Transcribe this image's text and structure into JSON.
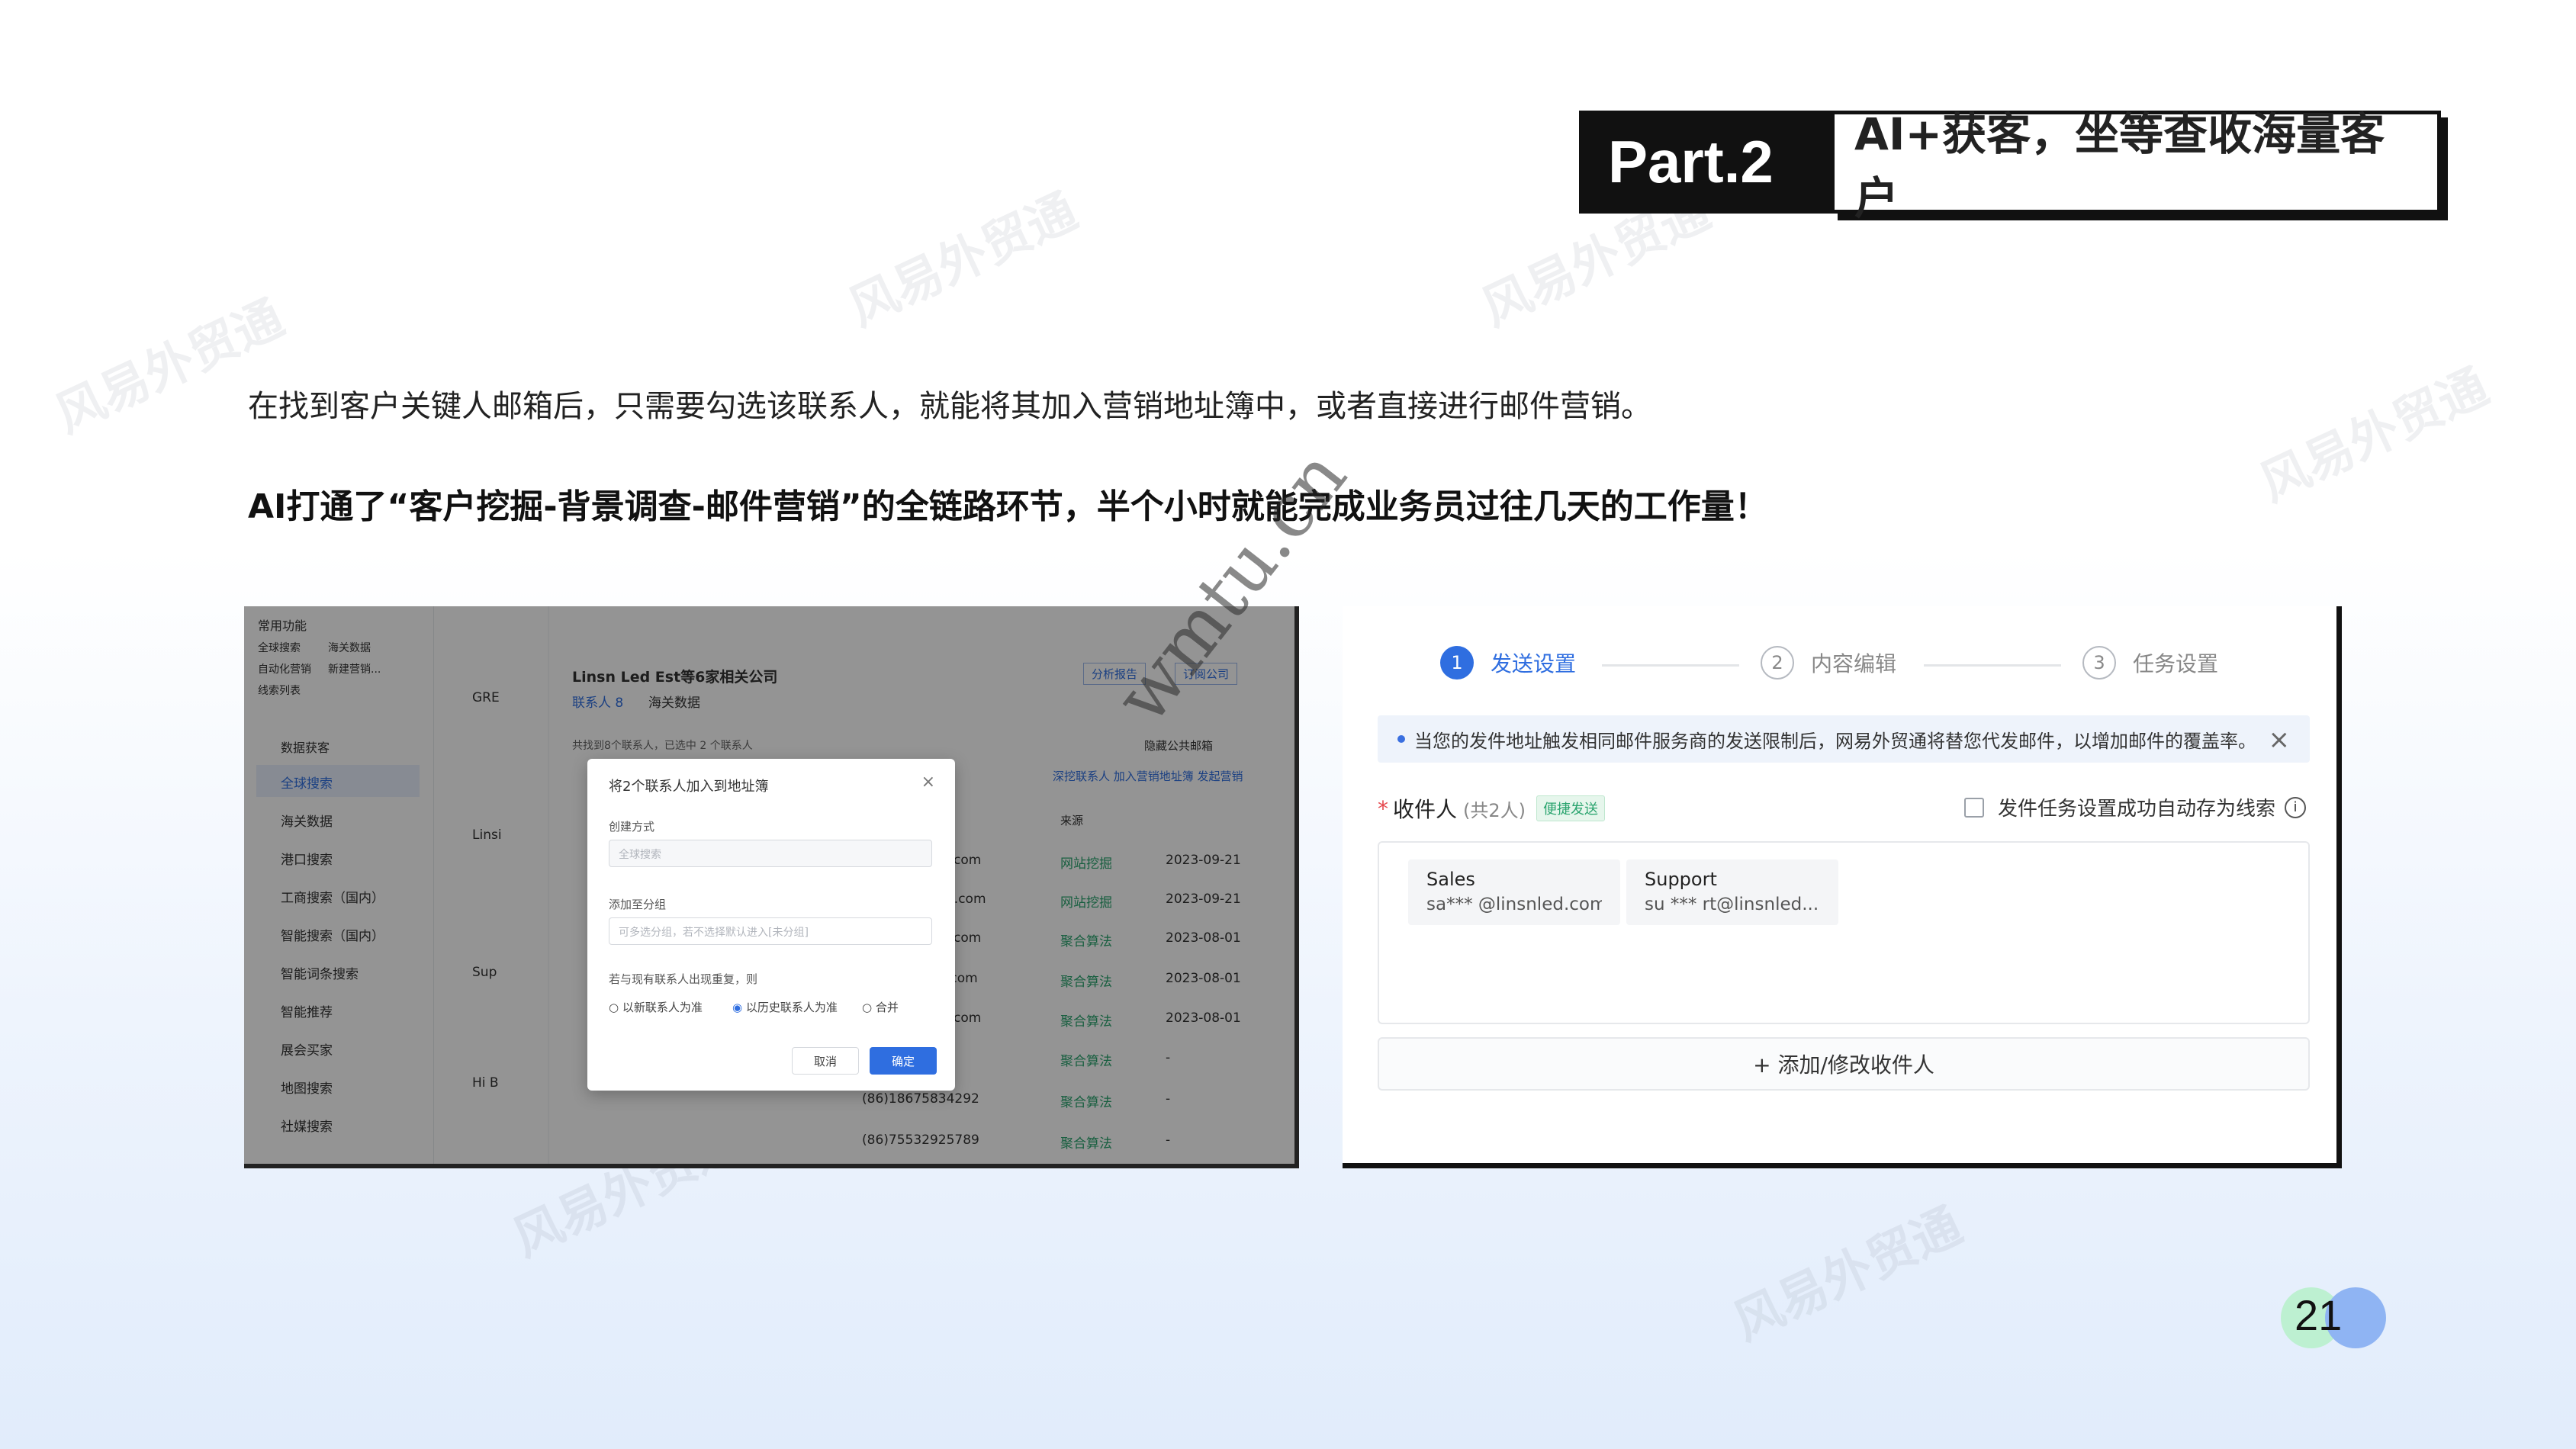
{
  "header": {
    "part_label": "Part.2",
    "title": "AI+获客，坐等查收海量客户"
  },
  "intro_text": "在找到客户关键人邮箱后，只需要勾选该联系人，就能将其加入营销地址簿中，或者直接进行邮件营销。",
  "highlight_text": "AI打通了“客户挖掘-背景调查-邮件营销”的全链路环节，半个小时就能完成业务员过往几天的工作量！",
  "watermarks": [
    "风易外贸通",
    "风易外贸通",
    "风易外贸通",
    "风易外贸通",
    "风易外贸通",
    "风易外贸通",
    "风易外贸通"
  ],
  "diag_watermark": "wmtu.cn",
  "left_shot": {
    "side_head_1": "常用功能",
    "side_row_1a": "全球搜索",
    "side_row_1b": "海关数据",
    "side_row_2a": "自动化营销",
    "side_row_2b": "新建营销...",
    "side_row_3": "线索列表",
    "side_section": "数据获客",
    "side_items": [
      "全球搜索",
      "海关数据",
      "港口搜索",
      "工商搜索（国内）",
      "智能搜索（国内）",
      "智能词条搜索",
      "智能推荐",
      "展会买家",
      "地图搜索",
      "社媒搜索"
    ],
    "company": "Linsn Led Est等6家相关公司",
    "tab_contacts": "联系人 8",
    "tab_customs": "海关数据",
    "btn_report": "分析报告",
    "btn_sub": "订阅公司",
    "hint": "共找到8个联系人，已选中 2 个联系人",
    "hide_public": "隐藏公共邮箱",
    "col_source": "来源",
    "actions": "深挖联系人  加入营销地址簿  发起营销",
    "rows": [
      {
        "mail": "com",
        "src": "网站挖掘",
        "date": "2023-09-21"
      },
      {
        "mail": "d.com",
        "src": "网站挖掘",
        "date": "2023-09-21"
      },
      {
        "mail": "com",
        "src": "聚合算法",
        "date": "2023-08-01"
      },
      {
        "mail": ".com",
        "src": "聚合算法",
        "date": "2023-08-01"
      },
      {
        "mail": "com",
        "src": "聚合算法",
        "date": "2023-08-01"
      },
      {
        "mail": "",
        "src": "聚合算法",
        "date": "-"
      },
      {
        "mail": "(86)18675834292",
        "src": "聚合算法",
        "date": "-"
      },
      {
        "mail": "(86)75532925789",
        "src": "聚合算法",
        "date": "-"
      }
    ],
    "list_names": [
      "GRE",
      "Linsi",
      "Sup",
      "Hi B"
    ],
    "modal": {
      "title": "将2个联系人加入到地址簿",
      "create_label": "创建方式",
      "create_value": "全球搜索",
      "group_label": "添加至分组",
      "group_placeholder": "可多选分组，若不选择默认进入[未分组]",
      "dup_label": "若与现有联系人出现重复，则",
      "opt_new": "以新联系人为准",
      "opt_old": "以历史联系人为准",
      "opt_merge": "合并",
      "cancel": "取消",
      "confirm": "确定"
    }
  },
  "right_shot": {
    "steps": [
      {
        "num": "1",
        "label": "发送设置"
      },
      {
        "num": "2",
        "label": "内容编辑"
      },
      {
        "num": "3",
        "label": "任务设置"
      }
    ],
    "notice": "当您的发件地址触发相同邮件服务商的发送限制后，网易外贸通将替您代发邮件，以增加邮件的覆盖率。",
    "recipient_label": "收件人",
    "recipient_count": "(共2人)",
    "tag": "便捷发送",
    "auto_save": "发件任务设置成功自动存为线索",
    "chips": [
      {
        "name": "Sales",
        "email": "sa*** @linsnled.com"
      },
      {
        "name": "Support",
        "email": "su *** rt@linsnled...."
      }
    ],
    "add_button": "+ 添加/修改收件人"
  },
  "page_number": "21"
}
